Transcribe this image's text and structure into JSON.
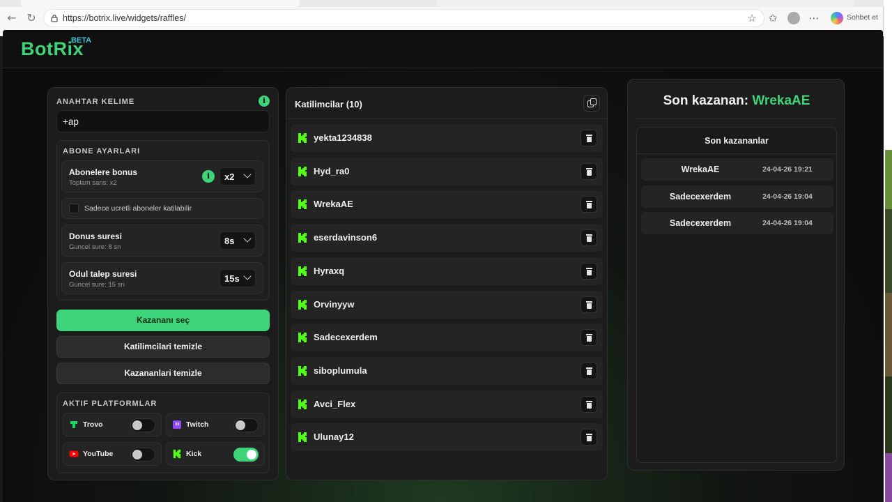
{
  "browser": {
    "url": "https://botrix.live/widgets/raffles/",
    "copilot_label": "Sohbet et"
  },
  "app": {
    "brand": "BotRix",
    "beta": "BETA"
  },
  "settings": {
    "keyword_label": "ANAHTAR KELIME",
    "keyword_value": "+ap",
    "sub_settings_label": "ABONE AYARLARI",
    "bonus_title": "Abonelere bonus",
    "bonus_sub": "Toplam sans: x2",
    "bonus_value": "x2",
    "paid_only_label": "Sadece ucretli aboneler katilabilir",
    "spin_title": "Donus suresi",
    "spin_sub": "Guncel sure: 8 sn",
    "spin_value": "8s",
    "claim_title": "Odul talep suresi",
    "claim_sub": "Guncel sure: 15 sn",
    "claim_value": "15s",
    "pick_winner": "Kazananı seç",
    "clear_participants": "Katilimcilari temizle",
    "clear_winners": "Kazananlari temizle",
    "platforms_label": "AKTIF PLATFORMLAR",
    "platforms": [
      {
        "name": "Trovo",
        "enabled": false,
        "color": "#19d66b"
      },
      {
        "name": "Twitch",
        "enabled": false,
        "color": "#9146ff"
      },
      {
        "name": "YouTube",
        "enabled": false,
        "color": "#ff0000"
      },
      {
        "name": "Kick",
        "enabled": true,
        "color": "#53fc18"
      }
    ]
  },
  "participants": {
    "title": "Katilimcilar (10)",
    "list": [
      "yekta1234838",
      "Hyd_ra0",
      "WrekaAE",
      "eserdavinson6",
      "Hyraxq",
      "Orvinyyw",
      "Sadecexerdem",
      "siboplumula",
      "Avci_Flex",
      "Ulunay12"
    ]
  },
  "winners": {
    "last_winner_prefix": "Son kazanan:",
    "last_winner_name": "WrekaAE",
    "recent_title": "Son kazananlar",
    "recent": [
      {
        "name": "WrekaAE",
        "date": "24-04-26 19:21"
      },
      {
        "name": "Sadecexerdem",
        "date": "24-04-26 19:04"
      },
      {
        "name": "Sadecexerdem",
        "date": "24-04-26 19:04"
      }
    ]
  },
  "colors": {
    "accent": "#3ed57a",
    "kick_green": "#53fc18",
    "background": "#0d0d0d"
  }
}
